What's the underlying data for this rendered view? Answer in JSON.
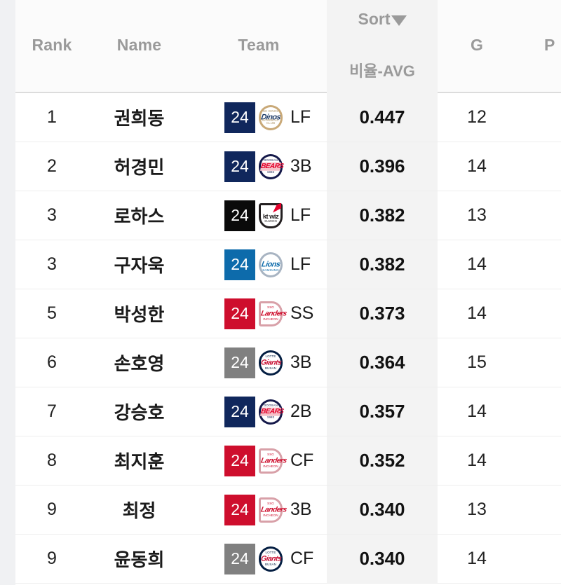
{
  "table": {
    "columns": {
      "rank": "Rank",
      "name": "Name",
      "team": "Team",
      "sort": "Sort",
      "avg": "비율-AVG",
      "g": "G",
      "next_partial": "P"
    },
    "sort_icon": "caret-down-icon",
    "sorted_by": "비율-AVG",
    "highlight_color": "#f3f3f3",
    "rows": [
      {
        "rank": "1",
        "name": "권희동",
        "number": "24",
        "team_code": "NC",
        "team_logo": "nc-dinos-logo",
        "logo_class": "logo-dinos",
        "logo_word": "Dinos",
        "logo_arc_top": "NC DINOS",
        "logo_arc_bot": "BASEBALL CLUB",
        "badge_color": "#10275c",
        "position": "LF",
        "avg": "0.447",
        "g": "12"
      },
      {
        "rank": "2",
        "name": "허경민",
        "number": "24",
        "team_code": "OB",
        "team_logo": "doosan-bears-logo",
        "logo_class": "logo-bears",
        "logo_word": "BEARS",
        "logo_arc_top": "DOOSAN",
        "logo_arc_bot": "1982",
        "badge_color": "#10275c",
        "position": "3B",
        "avg": "0.396",
        "g": "14"
      },
      {
        "rank": "3",
        "name": "로하스",
        "number": "24",
        "team_code": "KT",
        "team_logo": "kt-wiz-logo",
        "logo_class": "logo-ktwiz",
        "logo_word": "kt wiz",
        "logo_arc_top": "",
        "logo_arc_bot": "SUWON",
        "badge_color": "#0a0a0a",
        "position": "LF",
        "avg": "0.382",
        "g": "13"
      },
      {
        "rank": "3",
        "name": "구자욱",
        "number": "24",
        "team_code": "SS",
        "team_logo": "samsung-lions-logo",
        "logo_class": "logo-lions",
        "logo_word": "Lions",
        "logo_arc_top": "",
        "logo_arc_bot": "SAMSUNG",
        "badge_color": "#0d6bab",
        "position": "LF",
        "avg": "0.382",
        "g": "14"
      },
      {
        "rank": "5",
        "name": "박성한",
        "number": "24",
        "team_code": "SK",
        "team_logo": "ssg-landers-logo",
        "logo_class": "logo-landers",
        "logo_word": "Landers",
        "logo_arc_top": "SSG",
        "logo_arc_bot": "INCHEON",
        "badge_color": "#ce0e2d",
        "position": "SS",
        "avg": "0.373",
        "g": "14"
      },
      {
        "rank": "6",
        "name": "손호영",
        "number": "24",
        "team_code": "LT",
        "team_logo": "lotte-giants-logo",
        "logo_class": "logo-giants",
        "logo_word": "Giants",
        "logo_arc_top": "LOTTE",
        "logo_arc_bot": "BUSAN",
        "badge_color": "#808080",
        "position": "3B",
        "avg": "0.364",
        "g": "15"
      },
      {
        "rank": "7",
        "name": "강승호",
        "number": "24",
        "team_code": "OB",
        "team_logo": "doosan-bears-logo",
        "logo_class": "logo-bears",
        "logo_word": "BEARS",
        "logo_arc_top": "DOOSAN",
        "logo_arc_bot": "1982",
        "badge_color": "#10275c",
        "position": "2B",
        "avg": "0.357",
        "g": "14"
      },
      {
        "rank": "8",
        "name": "최지훈",
        "number": "24",
        "team_code": "SK",
        "team_logo": "ssg-landers-logo",
        "logo_class": "logo-landers",
        "logo_word": "Landers",
        "logo_arc_top": "SSG",
        "logo_arc_bot": "INCHEON",
        "badge_color": "#ce0e2d",
        "position": "CF",
        "avg": "0.352",
        "g": "14"
      },
      {
        "rank": "9",
        "name": "최정",
        "number": "24",
        "team_code": "SK",
        "team_logo": "ssg-landers-logo",
        "logo_class": "logo-landers",
        "logo_word": "Landers",
        "logo_arc_top": "SSG",
        "logo_arc_bot": "INCHEON",
        "badge_color": "#ce0e2d",
        "position": "3B",
        "avg": "0.340",
        "g": "13"
      },
      {
        "rank": "9",
        "name": "윤동희",
        "number": "24",
        "team_code": "LT",
        "team_logo": "lotte-giants-logo",
        "logo_class": "logo-giants",
        "logo_word": "Giants",
        "logo_arc_top": "LOTTE",
        "logo_arc_bot": "BUSAN",
        "badge_color": "#808080",
        "position": "CF",
        "avg": "0.340",
        "g": "14"
      }
    ]
  }
}
